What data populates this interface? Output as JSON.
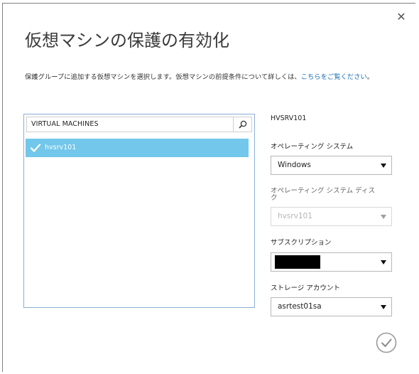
{
  "dialog": {
    "title": "仮想マシンの保護の有効化",
    "description_text": "保護グループに追加する仮想マシンを選択します。仮想マシンの前提条件について詳しくは、",
    "description_link": "こちらをご覧ください",
    "description_end": "。",
    "close_icon": "close-icon"
  },
  "vm_list": {
    "search_label": "VIRTUAL MACHINES",
    "search_icon": "search-icon",
    "items": [
      {
        "name": "hvsrv101",
        "selected": true
      }
    ],
    "selected_color": "#72c7ea"
  },
  "form": {
    "vm_heading": "HVSRV101",
    "os_label": "オペレーティング システム",
    "os_value": "Windows",
    "os_disk_label": "オペレーティング システム ディスク",
    "os_disk_value": "hvsrv101",
    "subscription_label": "サブスクリプション",
    "subscription_value": "",
    "storage_label": "ストレージ アカウント",
    "storage_value": "asrtest01sa"
  },
  "footer": {
    "ok_icon": "checkmark-circle-icon"
  },
  "colors": {
    "link": "#1a6fb3",
    "panel_border": "#8aaed6"
  }
}
